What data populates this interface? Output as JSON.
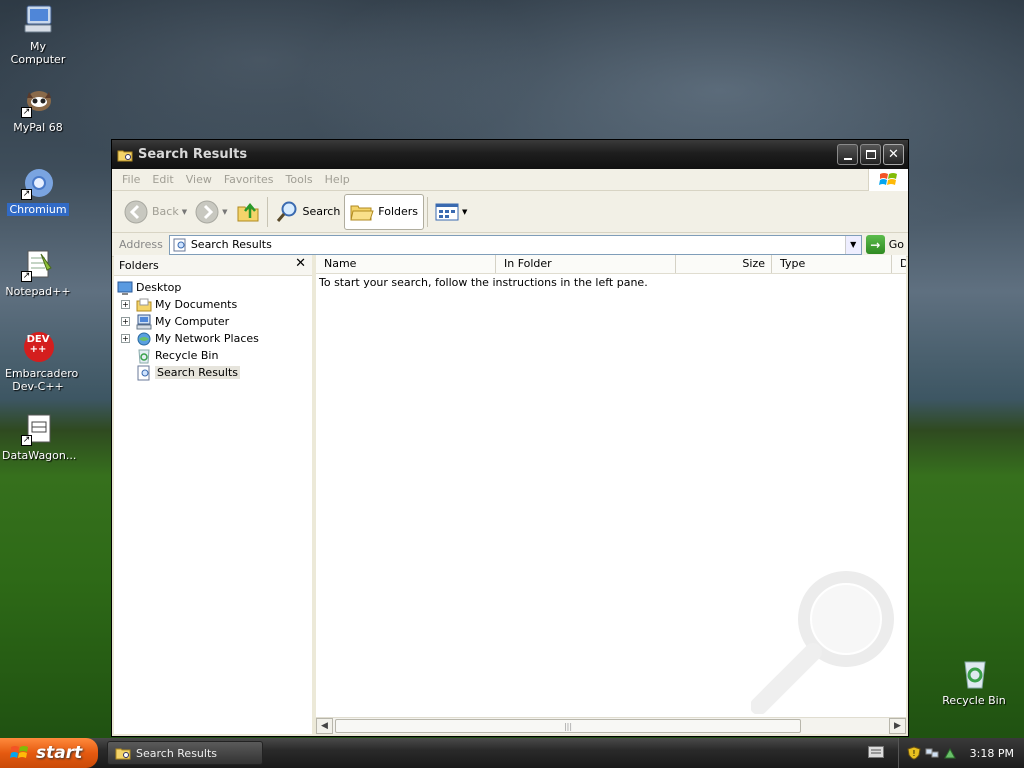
{
  "desktop": {
    "icons": [
      {
        "label": "My Computer"
      },
      {
        "label": "MyPal 68"
      },
      {
        "label": "Chromium"
      },
      {
        "label": "Notepad++"
      },
      {
        "label": "Embarcadero Dev-C++"
      },
      {
        "label": "DataWagon..."
      },
      {
        "label": "Recycle Bin"
      }
    ],
    "dev_icon_text": "DEV\n++"
  },
  "window": {
    "title": "Search Results",
    "menu": [
      "File",
      "Edit",
      "View",
      "Favorites",
      "Tools",
      "Help"
    ],
    "toolbar": {
      "back_label": "Back",
      "search_label": "Search",
      "folders_label": "Folders"
    },
    "address": {
      "label": "Address",
      "value": "Search Results",
      "go_label": "Go"
    },
    "folders_pane": {
      "title": "Folders",
      "close_glyph": "✕",
      "tree": [
        {
          "label": "Desktop"
        },
        {
          "label": "My Documents"
        },
        {
          "label": "My Computer"
        },
        {
          "label": "My Network Places"
        },
        {
          "label": "Recycle Bin"
        },
        {
          "label": "Search Results"
        }
      ]
    },
    "results": {
      "columns": [
        "Name",
        "In Folder",
        "Size",
        "Type",
        "D"
      ],
      "empty_message": "To start your search, follow the instructions in the left pane."
    }
  },
  "taskbar": {
    "start_label": "start",
    "task_label": "Search Results",
    "clock": "3:18 PM"
  },
  "colors": {
    "selection": "#316ac5",
    "start_orange": "#e55a10",
    "go_green": "#2f8a22"
  }
}
